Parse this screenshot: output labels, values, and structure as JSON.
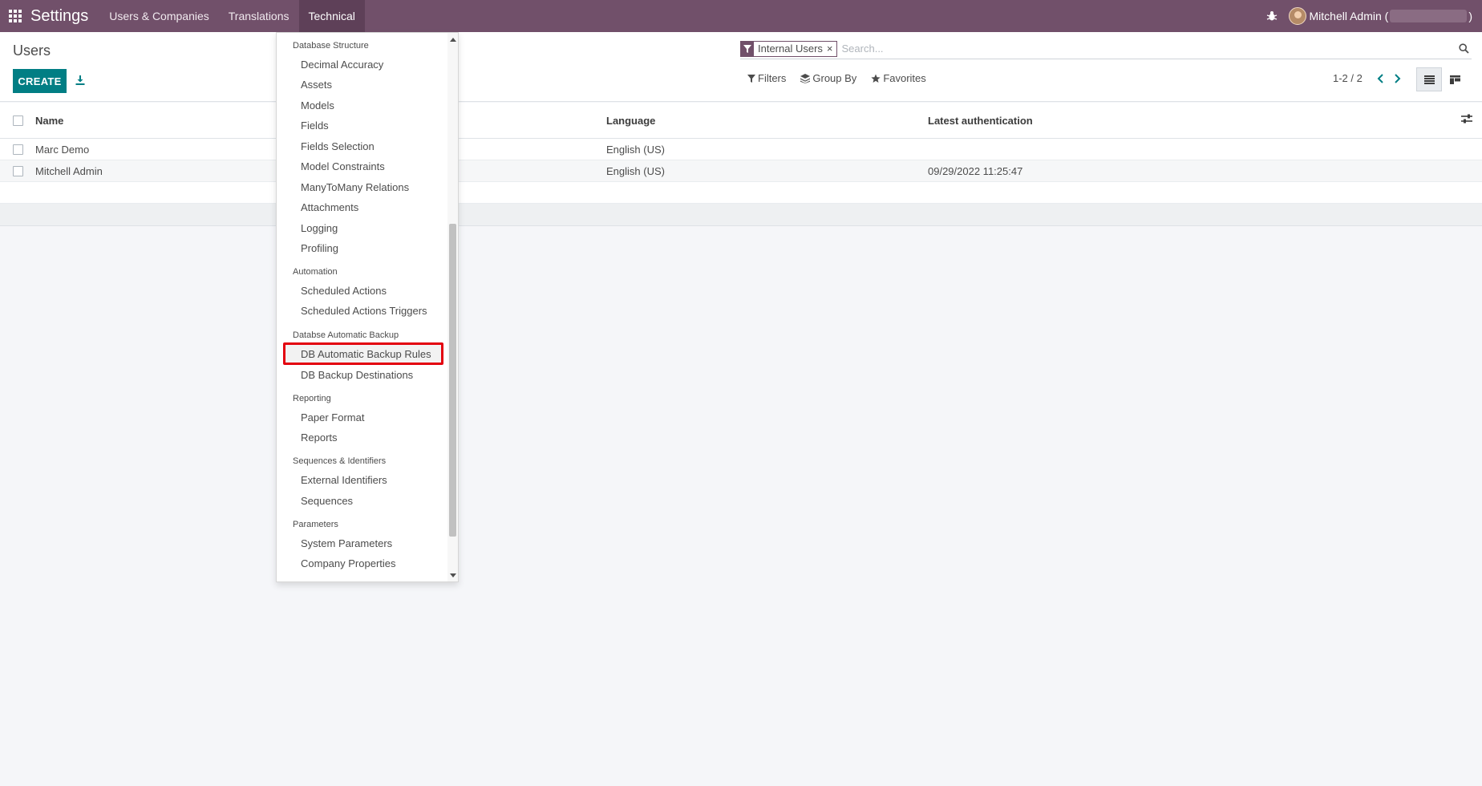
{
  "navbar": {
    "app_title": "Settings",
    "menus": [
      "Users & Companies",
      "Translations",
      "Technical"
    ],
    "active_menu": "Technical",
    "user": "Mitchell Admin (",
    "user_suffix": ")",
    "color": "#71506a"
  },
  "control_panel": {
    "title": "Users",
    "create_label": "CREATE",
    "search": {
      "facet_value": "Internal Users",
      "facet_remove": "×",
      "placeholder": "Search..."
    },
    "filters_label": "Filters",
    "group_by_label": "Group By",
    "favorites_label": "Favorites",
    "pager_value": "1-2 / 2"
  },
  "table": {
    "headers": {
      "name": "Name",
      "language": "Language",
      "latest_auth": "Latest authentication"
    },
    "rows": [
      {
        "name": "Marc Demo",
        "language": "English (US)",
        "latest_auth": ""
      },
      {
        "name": "Mitchell Admin",
        "language": "English (US)",
        "latest_auth": "09/29/2022 11:25:47"
      }
    ]
  },
  "technical_menu": {
    "sections": [
      {
        "header": "Database Structure",
        "items": [
          "Decimal Accuracy",
          "Assets",
          "Models",
          "Fields",
          "Fields Selection",
          "Model Constraints",
          "ManyToMany Relations",
          "Attachments",
          "Logging",
          "Profiling"
        ]
      },
      {
        "header": "Automation",
        "items": [
          "Scheduled Actions",
          "Scheduled Actions Triggers"
        ]
      },
      {
        "header": "Databse Automatic Backup",
        "items": [
          "DB Automatic Backup Rules",
          "DB Backup Destinations"
        ]
      },
      {
        "header": "Reporting",
        "items": [
          "Paper Format",
          "Reports"
        ]
      },
      {
        "header": "Sequences & Identifiers",
        "items": [
          "External Identifiers",
          "Sequences"
        ]
      },
      {
        "header": "Parameters",
        "items": [
          "System Parameters",
          "Company Properties"
        ]
      }
    ],
    "highlighted_item": "DB Automatic Backup Rules",
    "highlight_color": "#e3000f"
  }
}
